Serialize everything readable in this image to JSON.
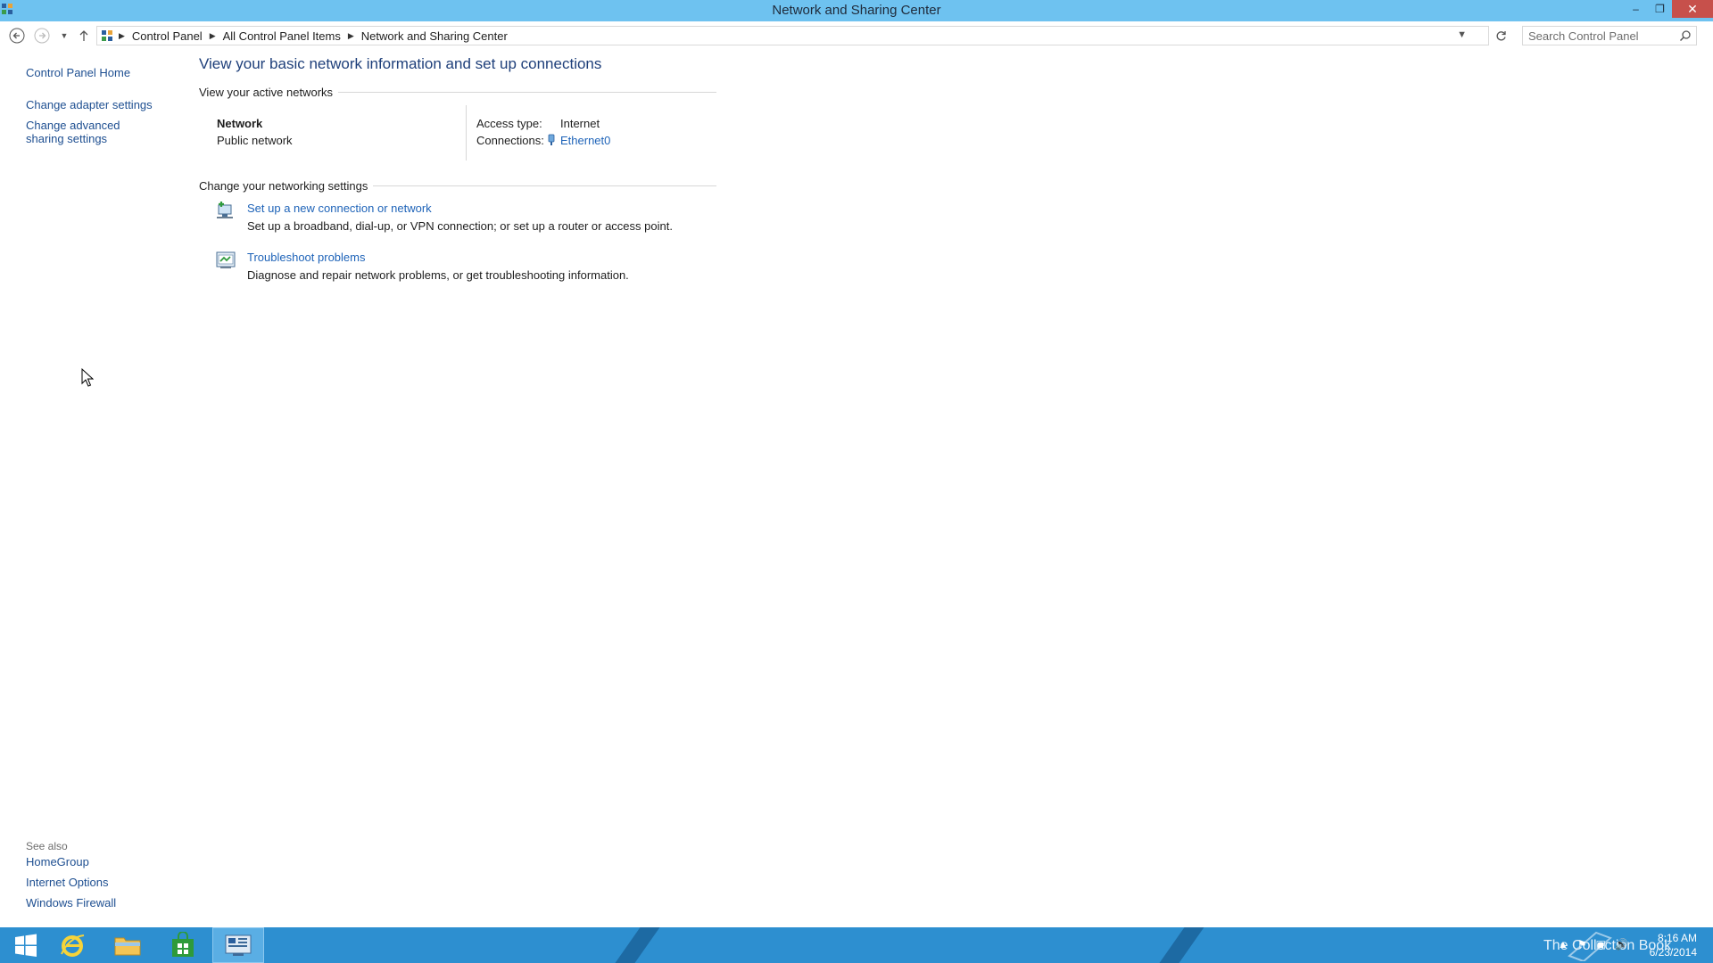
{
  "window": {
    "title": "Network and Sharing Center",
    "controls": {
      "minimize": "–",
      "restore": "❐",
      "close": "✕"
    }
  },
  "address": {
    "breadcrumbs": [
      "Control Panel",
      "All Control Panel Items",
      "Network and Sharing Center"
    ],
    "search_placeholder": "Search Control Panel"
  },
  "sidebar": {
    "home": "Control Panel Home",
    "links": [
      "Change adapter settings",
      "Change advanced sharing settings"
    ],
    "see_also_label": "See also",
    "see_also": [
      "HomeGroup",
      "Internet Options",
      "Windows Firewall"
    ]
  },
  "main": {
    "title": "View your basic network information and set up connections",
    "active_networks_header": "View your active networks",
    "network": {
      "name": "Network",
      "type": "Public network",
      "access_type_label": "Access type:",
      "access_type_value": "Internet",
      "connections_label": "Connections:",
      "connections_value": "Ethernet0"
    },
    "change_settings_header": "Change your networking settings",
    "tasks": [
      {
        "link": "Set up a new connection or network",
        "desc": "Set up a broadband, dial-up, or VPN connection; or set up a router or access point.",
        "icon": "new-connection-icon"
      },
      {
        "link": "Troubleshoot problems",
        "desc": "Diagnose and repair network problems, or get troubleshooting information.",
        "icon": "troubleshoot-icon"
      }
    ]
  },
  "taskbar": {
    "watermark": "The Collection Book",
    "time": "8:16 AM",
    "date": "6/23/2014"
  },
  "colors": {
    "titlebar": "#6ec2f0",
    "link": "#1e63b8",
    "taskbar": "#2d8fd0",
    "close_button": "#c7504b"
  }
}
